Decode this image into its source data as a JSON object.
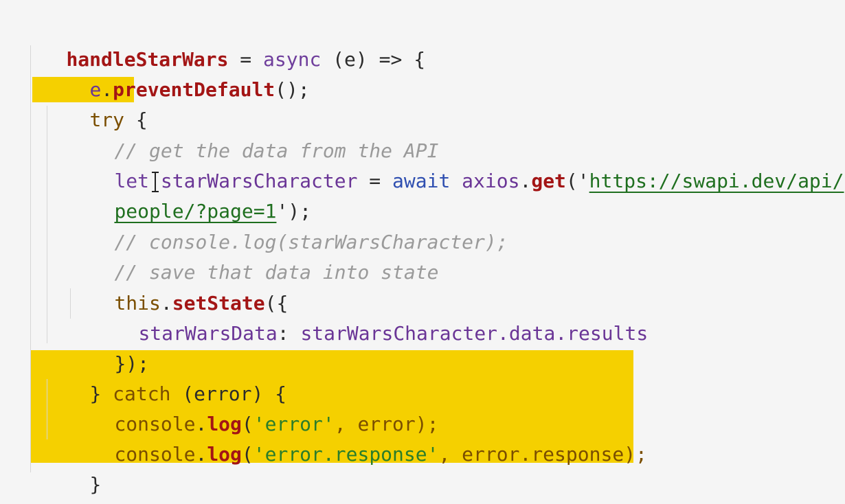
{
  "code": {
    "l1": {
      "name": "handleStarWars",
      "op": " = ",
      "async": "async",
      "params": " (e) => {"
    },
    "l2": {
      "obj": "e",
      "dot": ".",
      "method": "preventDefault",
      "rest": "();"
    },
    "l3": {
      "try": "try",
      "brace": " {"
    },
    "l4": {
      "comment": "// get the data from the API"
    },
    "l5": {
      "let": "let",
      "var": " starWarsCharacter",
      "eq": " = ",
      "await": "await",
      "obj": " axios",
      "dot": ".",
      "method": "get",
      "open": "('",
      "url": "https://swapi.dev/api/"
    },
    "l6": {
      "url": "people/?page=1",
      "close": "');"
    },
    "l7": {
      "comment": "// console.log(starWarsCharacter);"
    },
    "l8": {
      "comment": "// save that data into state"
    },
    "l9": {
      "this": "this",
      "dot": ".",
      "method": "setState",
      "open": "({"
    },
    "l10": {
      "key": "starWarsData",
      "colon": ": ",
      "value": "starWarsCharacter.data.results"
    },
    "l11": {
      "close": "});"
    },
    "l12": {
      "close": "} ",
      "catch": "catch",
      "params": " (error) {"
    },
    "l13": {
      "obj": "console",
      "dot": ".",
      "method": "log",
      "open": "(",
      "str": "'error'",
      "rest": ", error);"
    },
    "l14": {
      "obj": "console",
      "dot": ".",
      "method": "log",
      "open": "(",
      "str": "'error.response'",
      "rest": ", error.response);"
    },
    "l15": {
      "close": "}"
    },
    "l16": {
      "close": "};"
    }
  },
  "colors": {
    "background": "#f5f5f5",
    "highlight": "#f5d000",
    "function": "#a31515",
    "keyword": "#6f3e9c",
    "comment": "#9a9a9a",
    "string": "#2a7d2a"
  }
}
